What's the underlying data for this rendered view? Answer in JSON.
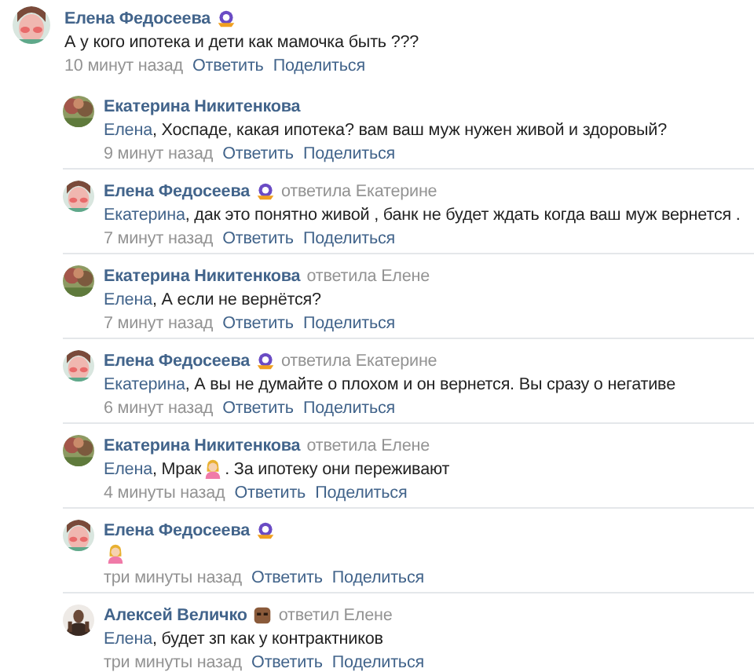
{
  "comment": {
    "author": "Елена Федосеева",
    "badge": {
      "kind": "emblem"
    },
    "body": [
      {
        "kind": "text",
        "text": "А у кого ипотека и дети как мамочка быть ???"
      }
    ],
    "time": "10 минут назад",
    "reply": "Ответить",
    "share": "Поделиться"
  },
  "replies": [
    {
      "author": "Екатерина Никитенкова",
      "addressee": "Елена",
      "body": [
        {
          "kind": "text",
          "text": ", Хоспаде, какая ипотека? вам ваш муж нужен живой и здоровый?"
        }
      ],
      "time": "9 минут назад",
      "reply": "Ответить",
      "share": "Поделиться"
    },
    {
      "author": "Елена Федосеева",
      "badge": {
        "kind": "emblem"
      },
      "replied_to": "ответила Екатерине",
      "addressee": "Екатерина",
      "body": [
        {
          "kind": "text",
          "text": ", дак это понятно живой , банк не будет ждать когда ваш муж вернется ."
        }
      ],
      "time": "7 минут назад",
      "reply": "Ответить",
      "share": "Поделиться"
    },
    {
      "author": "Екатерина Никитенкова",
      "replied_to": "ответила Елене",
      "addressee": "Елена",
      "body": [
        {
          "kind": "text",
          "text": ", А если не вернётся?"
        }
      ],
      "time": "7 минут назад",
      "reply": "Ответить",
      "share": "Поделиться"
    },
    {
      "author": "Елена Федосеева",
      "badge": {
        "kind": "emblem"
      },
      "replied_to": "ответила Екатерине",
      "addressee": "Екатерина",
      "body": [
        {
          "kind": "text",
          "text": ", А вы не думайте о плохом и он вернется. Вы сразу о негативе"
        }
      ],
      "time": "6 минут назад",
      "reply": "Ответить",
      "share": "Поделиться"
    },
    {
      "author": "Екатерина Никитенкова",
      "replied_to": "ответила Елене",
      "addressee": "Елена",
      "body": [
        {
          "kind": "text",
          "text": ", Мрак "
        },
        {
          "kind": "emoji"
        },
        {
          "kind": "text",
          "text": ". За ипотеку они переживают"
        }
      ],
      "time": "4 минуты назад",
      "reply": "Ответить",
      "share": "Поделиться"
    },
    {
      "author": "Елена Федосеева",
      "badge": {
        "kind": "emblem"
      },
      "body": [
        {
          "kind": "emoji"
        }
      ],
      "time": "три минуты назад",
      "reply": "Ответить",
      "share": "Поделиться"
    },
    {
      "author": "Алексей Величко",
      "badge": {
        "kind": "mask"
      },
      "replied_to": "ответил Елене",
      "addressee": "Елена",
      "body": [
        {
          "kind": "text",
          "text": ", будет зп как у контрактников"
        }
      ],
      "time": "три минуты назад",
      "reply": "Ответить",
      "share": "Поделиться"
    }
  ]
}
